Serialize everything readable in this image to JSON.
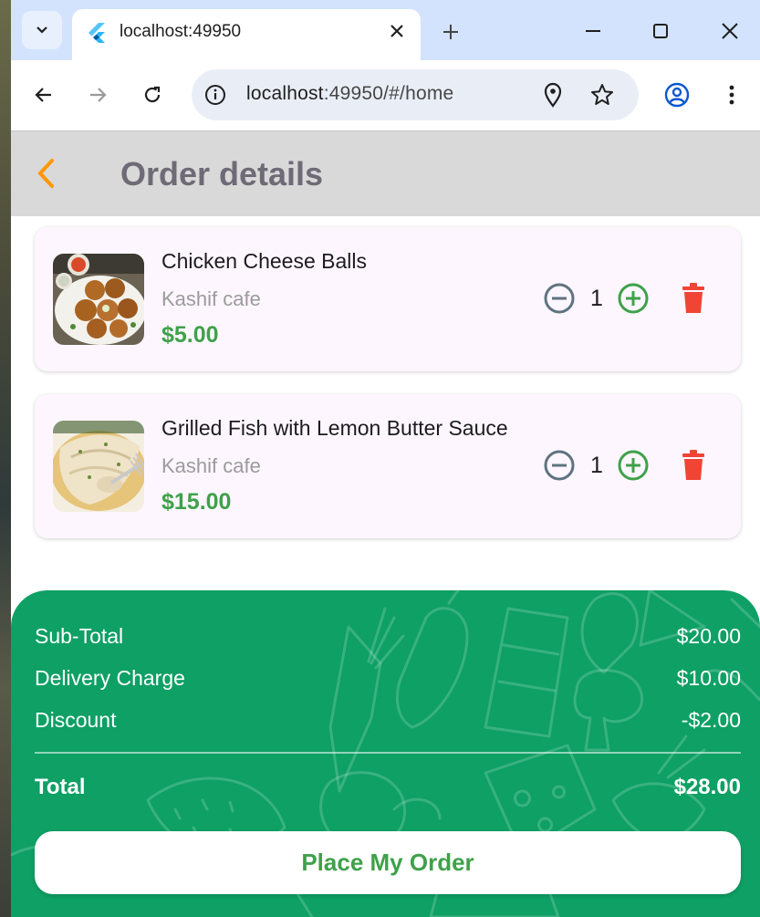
{
  "browser": {
    "tab_title": "localhost:49950",
    "url_host": "localhost",
    "url_rest": ":49950/#/home"
  },
  "app": {
    "title": "Order details",
    "accent": "#ff9800",
    "green": "#0ea065"
  },
  "items": [
    {
      "name": "Chicken Cheese Balls",
      "shop": "Kashif cafe",
      "price": "$5.00",
      "qty": "1"
    },
    {
      "name": "Grilled Fish with Lemon Butter Sauce",
      "shop": "Kashif cafe",
      "price": "$15.00",
      "qty": "1"
    }
  ],
  "summary": {
    "subtotal_label": "Sub-Total",
    "subtotal_value": "$20.00",
    "delivery_label": "Delivery Charge",
    "delivery_value": "$10.00",
    "discount_label": "Discount",
    "discount_value": "-$2.00",
    "total_label": "Total",
    "total_value": "$28.00",
    "button_label": "Place My Order"
  }
}
